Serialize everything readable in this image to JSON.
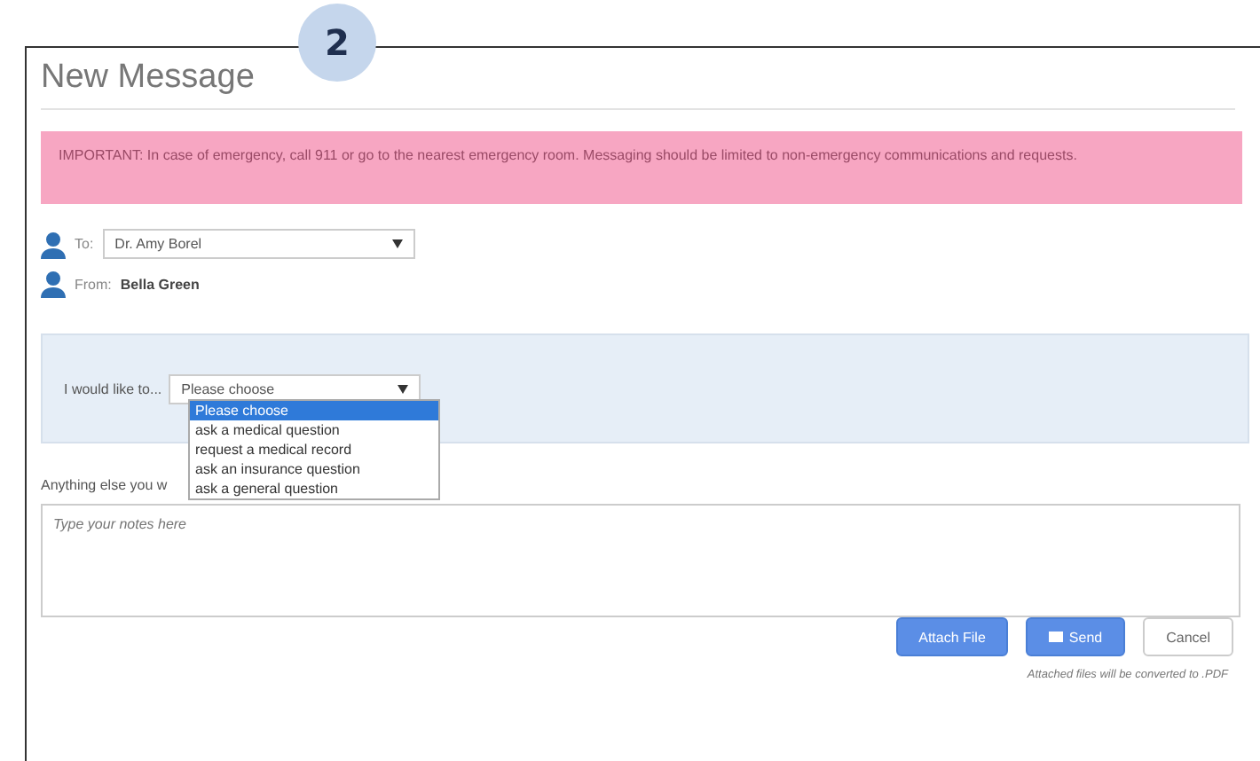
{
  "step_badge": "2",
  "title": "New Message",
  "alert": "IMPORTANT: In case of emergency, call 911 or go to the nearest emergency room. Messaging should be limited to non-emergency communications and requests.",
  "to": {
    "label": "To:",
    "value": "Dr. Amy Borel"
  },
  "from": {
    "label": "From:",
    "value": "Bella Green"
  },
  "intent": {
    "label": "I would like to...",
    "value": "Please choose",
    "options": [
      {
        "label": "Please choose",
        "selected": true
      },
      {
        "label": "ask a medical question",
        "selected": false
      },
      {
        "label": "request a medical record",
        "selected": false
      },
      {
        "label": "ask an insurance question",
        "selected": false
      },
      {
        "label": "ask a general question",
        "selected": false
      }
    ]
  },
  "notes": {
    "label": "Anything else you w",
    "placeholder": "Type your notes here"
  },
  "buttons": [
    {
      "kind": "attach",
      "label": "Attach File"
    },
    {
      "kind": "send",
      "label": "Send"
    },
    {
      "kind": "cancel",
      "label": "Cancel"
    }
  ],
  "footnote": "Attached files will be converted to .PDF"
}
